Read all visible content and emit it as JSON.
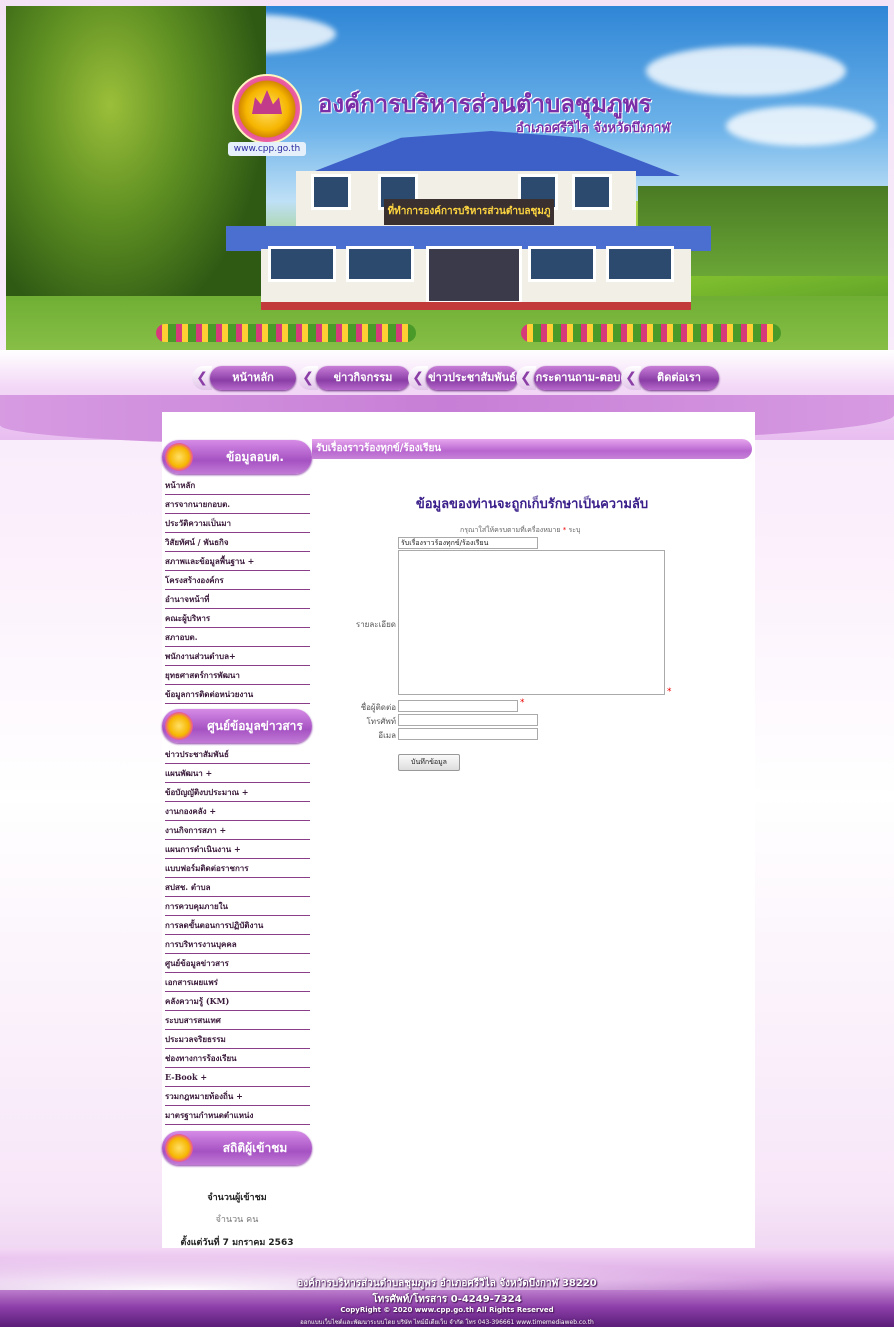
{
  "header": {
    "org_title": "องค์การบริหารส่วนตำบลชุมภูพร",
    "subtitle": "อำเภอศรีวิไล จังหวัดบึงกาฬ",
    "website": "www.cpp.go.th",
    "building_sign": "ที่ทำการองค์การบริหารส่วนตำบลชุมภูพร"
  },
  "nav": [
    {
      "label": "หน้าหลัก"
    },
    {
      "label": "ข่าวกิจกรรม"
    },
    {
      "label": "ข่าวประชาสัมพันธ์"
    },
    {
      "label": "กระดานถาม-ตอบ"
    },
    {
      "label": "ติดต่อเรา"
    }
  ],
  "sidebar": {
    "section1_title": "ข้อมูลอบต.",
    "section1_items": [
      "หน้าหลัก",
      "สารจากนายกอบต.",
      "ประวัติความเป็นมา",
      "วิสัยทัศน์ / พันธกิจ",
      "สภาพและข้อมูลพื้นฐาน +",
      "โครงสร้างองค์กร",
      "อำนาจหน้าที่",
      "คณะผู้บริหาร",
      "สภาอบต.",
      "พนักงานส่วนตำบล+",
      "ยุทธศาสตร์การพัฒนา",
      "ข้อมูลการติดต่อหน่วยงาน"
    ],
    "section2_title": "ศูนย์ข้อมูลข่าวสาร",
    "section2_items": [
      "ข่าวประชาสัมพันธ์",
      "แผนพัฒนา +",
      "ข้อบัญญัติงบประมาณ +",
      "งานกองคลัง +",
      "งานกิจการสภา +",
      "แผนการดำเนินงาน +",
      "แบบฟอร์มติดต่อราชการ",
      "สปสช. ตำบล",
      "การควบคุมภายใน",
      "การลดขั้นตอนการปฏิบัติงาน",
      "การบริหารงานบุคคล",
      "ศูนย์ข้อมูลข่าวสาร",
      "เอกสารเผยแพร่",
      "คลังความรู้ (KM)",
      "ระบบสารสนเทศ",
      "ประมวลจริยธรรม",
      "ช่องทางการร้องเรียน",
      "E-Book +",
      "รวมกฎหมายท้องถิ่น +",
      "มาตรฐานกำหนดตำแหน่ง"
    ],
    "section3_title": "สถิติผู้เข้าชม",
    "visitors_label": "จำนวนผู้เข้าชม",
    "visitors_count": "จำนวน คน",
    "since": "ตั้งแต่วันที่ 7 มกราคม 2563"
  },
  "main": {
    "section_title": "รับเรื่องราวร้องทุกข์/ร้องเรียน",
    "confidential": "ข้อมูลของท่านจะถูกเก็บรักษาเป็นความลับ",
    "required_note": "กรุณาใส่ให้ครบตามที่เครื่องหมาย",
    "required_star": "*",
    "required_tail": "ระบุ",
    "subject_value": "รับเรื่องราวร้องทุกข์/ร้องเรียน",
    "detail_label": "รายละเอียด",
    "contact_label": "ชื่อผู้ติดต่อ",
    "phone_label": "โทรศัพท์",
    "email_label": "อีเมล",
    "submit_label": "บันทึกข้อมูล"
  },
  "footer": {
    "line1": "องค์การบริหารส่วนตำบลชุมภูพร อำเภอศรีวิไล จังหวัดบึงกาฬ 38220",
    "line2": "โทรศัพท์/โทรสาร 0-4249-7324",
    "line3": "CopyRight © 2020 www.cpp.go.th All Rights Reserved",
    "line4": "ออกแบบเว็บไซต์และพัฒนาระบบโดย บริษัท ไทม์มีเดียเว็บ จำกัด โทร 043-396661 www.timemediaweb.co.th"
  },
  "colors": {
    "accent": "#a552c2",
    "heading": "#3a1e8a",
    "required": "#ee0000"
  }
}
